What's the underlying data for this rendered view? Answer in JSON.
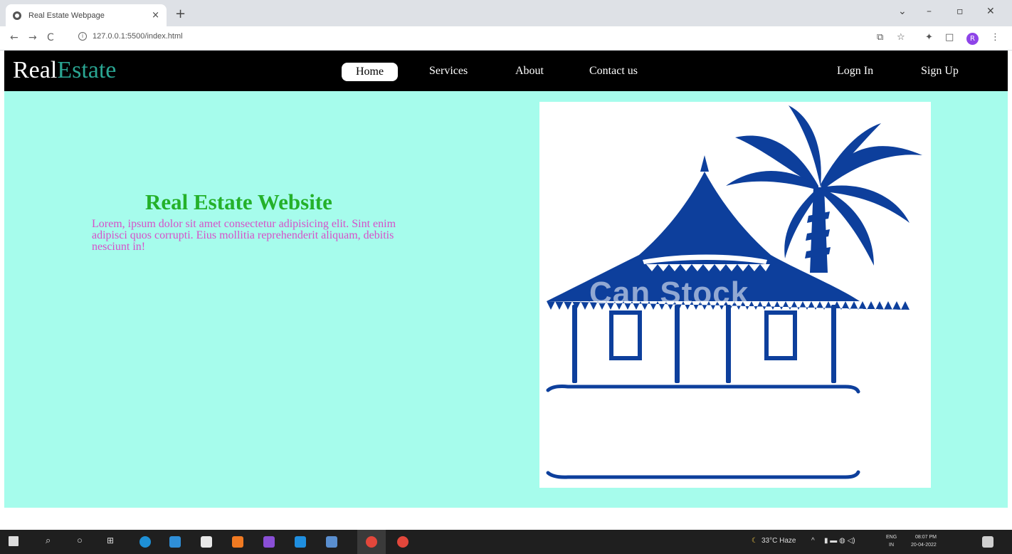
{
  "browser": {
    "tab_title": "Real Estate Webpage",
    "tab_close": "×",
    "new_tab": "+",
    "url": "127.0.0.1:5500/index.html",
    "profile_initial": "R",
    "window_controls": {
      "chevron": "⌄",
      "minimize": "–",
      "maximize": "▫",
      "close": "✕"
    },
    "nav": {
      "back": "←",
      "forward": "→",
      "reload": "C"
    }
  },
  "site": {
    "brand_part1": "Real",
    "brand_part2": "Estate",
    "nav": [
      "Home",
      "Services",
      "About",
      "Contact us"
    ],
    "auth": [
      "Logn In",
      "Sign Up"
    ],
    "hero_title": "Real Estate Website",
    "hero_text": "Lorem, ipsum dolor sit amet consectetur adipisicing elit. Sint enim adipisci quos corrupti. Eius mollitia reprehenderit aliquam, debitis nesciunt in!",
    "watermark": "Can Stock"
  },
  "taskbar": {
    "weather": "33°C Haze",
    "lang_top": "ENG",
    "lang_bottom": "IN",
    "time": "08:07 PM",
    "date": "20-04-2022"
  },
  "colors": {
    "hero_bg": "#a6fcec",
    "title": "#24b12a",
    "text": "#d74fc9",
    "brand_accent": "#2aa592",
    "house": "#0d3f9c"
  }
}
